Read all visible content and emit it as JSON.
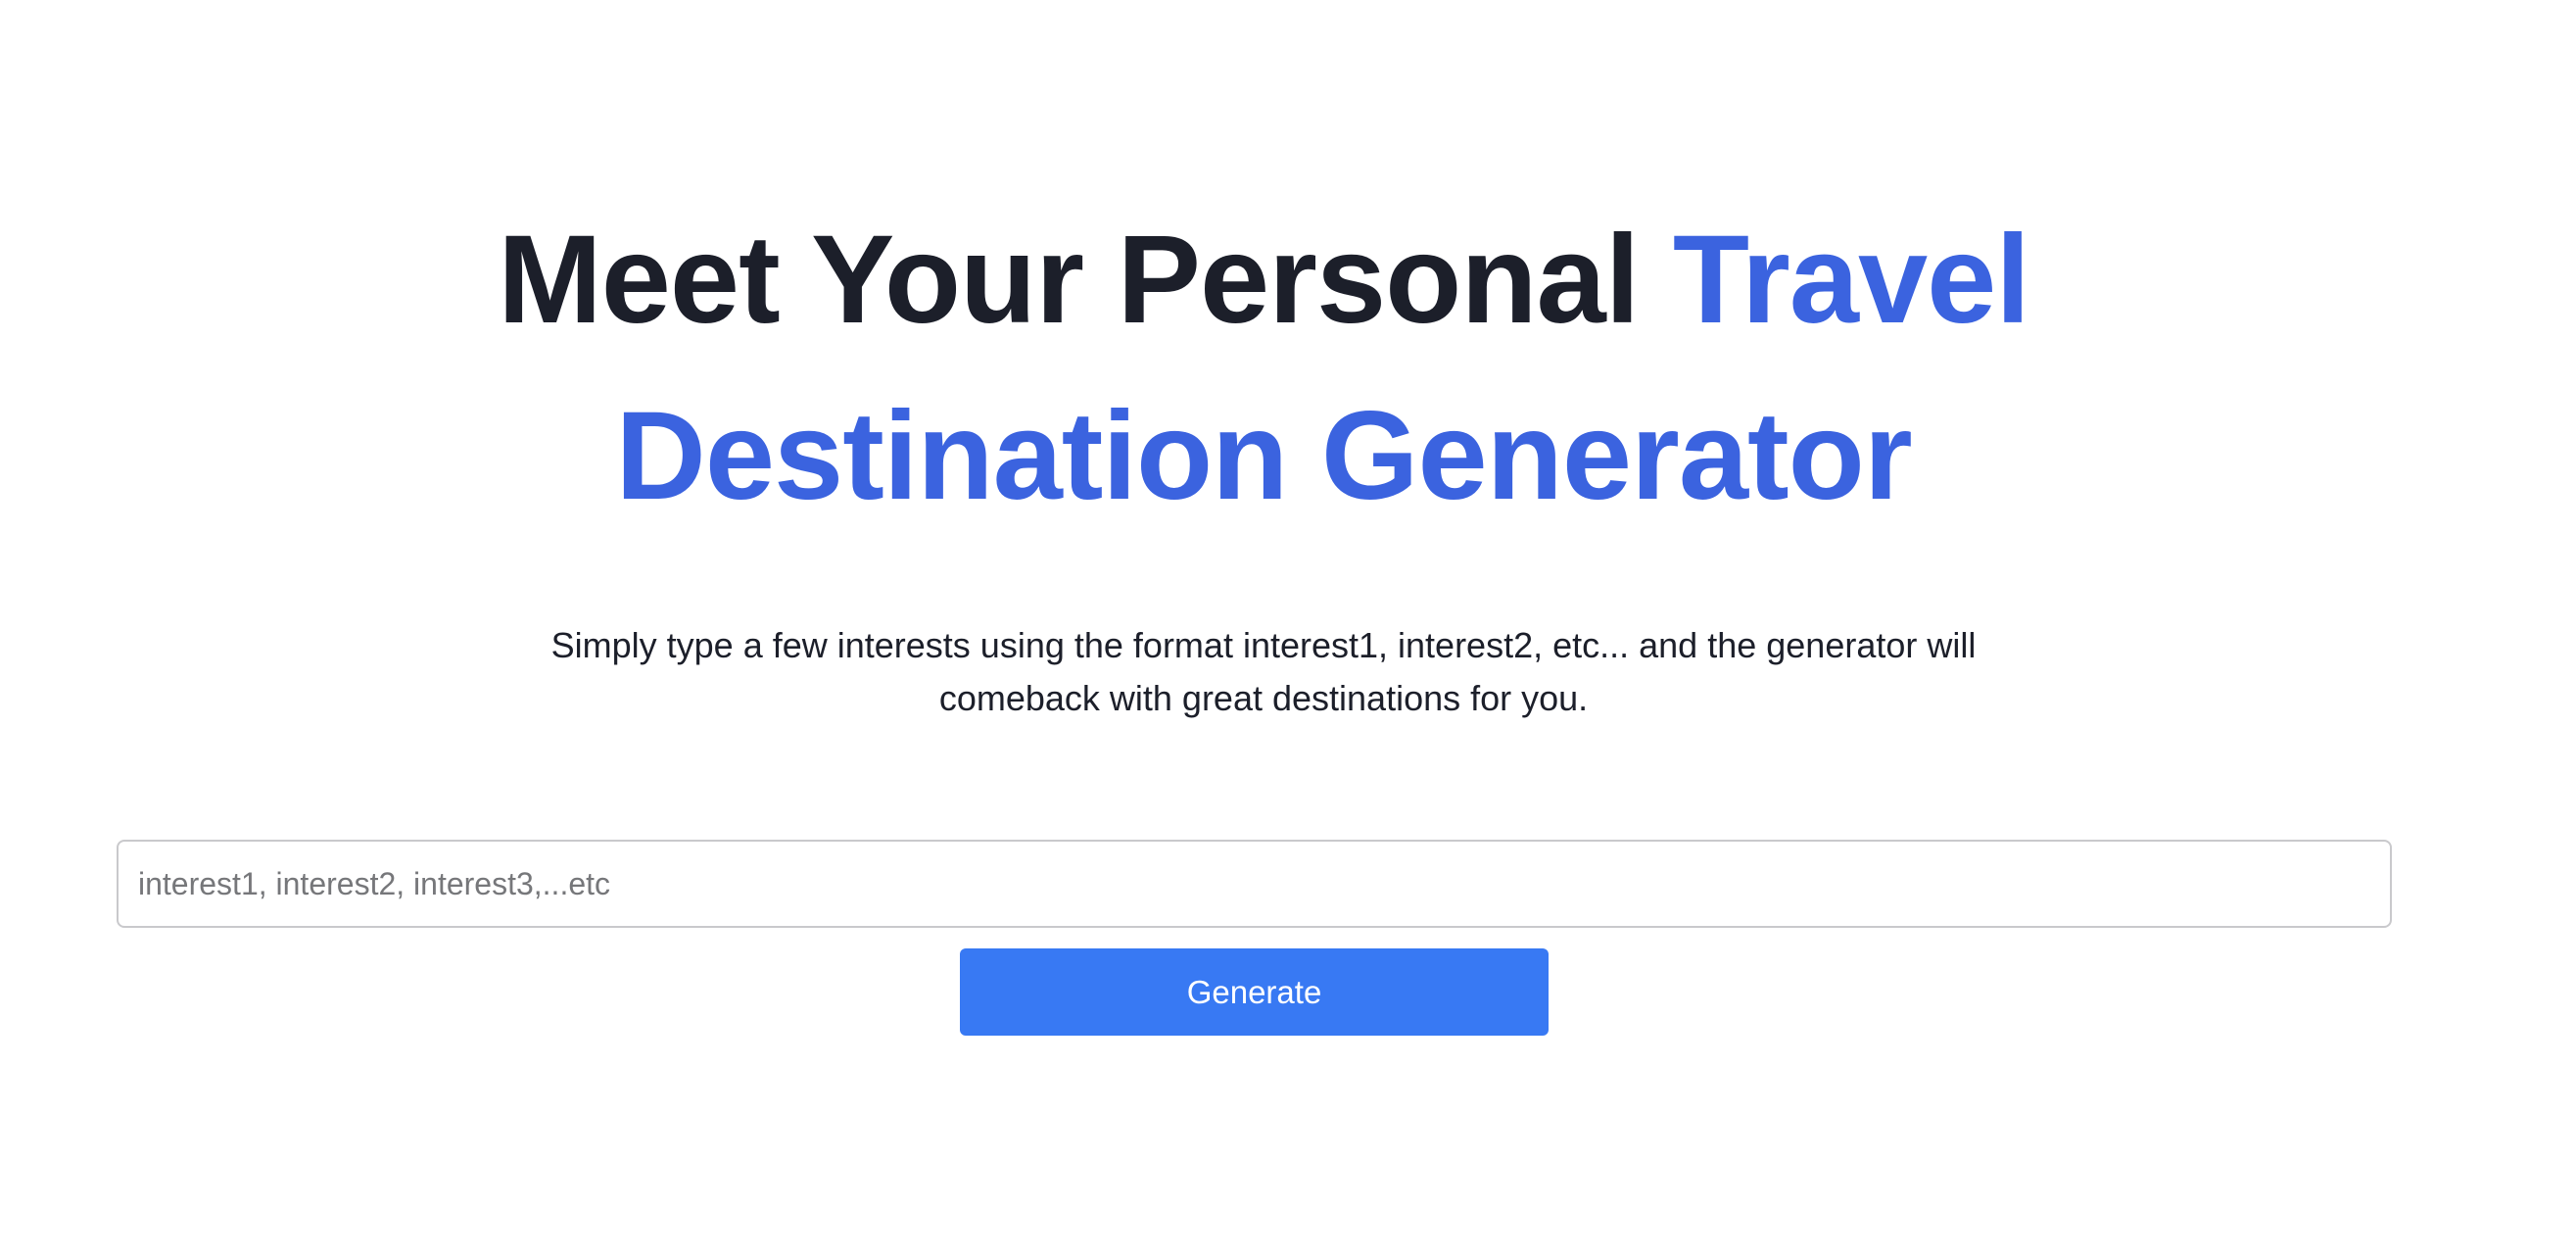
{
  "hero": {
    "title_plain": "Meet Your Personal ",
    "title_accent_1": "Travel",
    "title_accent_2": "Destination Generator"
  },
  "subtitle": "Simply type a few interests using the format interest1, interest2, etc... and the generator will comeback with great destinations for you.",
  "form": {
    "input_placeholder": "interest1, interest2, interest3,...etc",
    "input_value": "",
    "generate_label": "Generate"
  },
  "colors": {
    "accent": "#3b63df",
    "button": "#3879f3",
    "heading": "#1c1f2a"
  }
}
